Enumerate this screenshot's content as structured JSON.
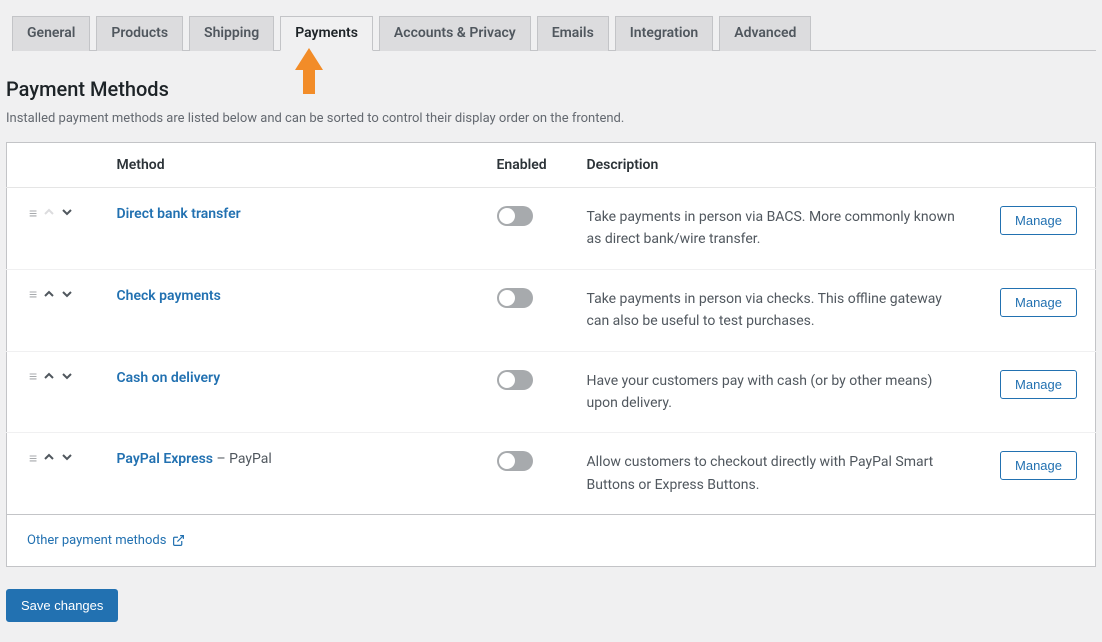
{
  "tabs": [
    {
      "label": "General"
    },
    {
      "label": "Products"
    },
    {
      "label": "Shipping"
    },
    {
      "label": "Payments"
    },
    {
      "label": "Accounts & Privacy"
    },
    {
      "label": "Emails"
    },
    {
      "label": "Integration"
    },
    {
      "label": "Advanced"
    }
  ],
  "active_tab": "Payments",
  "page": {
    "heading": "Payment Methods",
    "subtext": "Installed payment methods are listed below and can be sorted to control their display order on the frontend."
  },
  "columns": {
    "method": "Method",
    "enabled": "Enabled",
    "description": "Description"
  },
  "methods": [
    {
      "name": "Direct bank transfer",
      "suffix": "",
      "description": "Take payments in person via BACS. More commonly known as direct bank/wire transfer.",
      "enabled": false,
      "up_enabled": false,
      "down_enabled": true,
      "manage_label": "Manage"
    },
    {
      "name": "Check payments",
      "suffix": "",
      "description": "Take payments in person via checks. This offline gateway can also be useful to test purchases.",
      "enabled": false,
      "up_enabled": true,
      "down_enabled": true,
      "manage_label": "Manage"
    },
    {
      "name": "Cash on delivery",
      "suffix": "",
      "description": "Have your customers pay with cash (or by other means) upon delivery.",
      "enabled": false,
      "up_enabled": true,
      "down_enabled": true,
      "manage_label": "Manage"
    },
    {
      "name": "PayPal Express",
      "suffix": " – PayPal",
      "description": "Allow customers to checkout directly with PayPal Smart Buttons or Express Buttons.",
      "enabled": false,
      "up_enabled": true,
      "down_enabled": true,
      "manage_label": "Manage"
    }
  ],
  "footer": {
    "other_link": "Other payment methods"
  },
  "buttons": {
    "save": "Save changes"
  },
  "colors": {
    "accent": "#2271b1",
    "arrow": "#f28c28"
  }
}
